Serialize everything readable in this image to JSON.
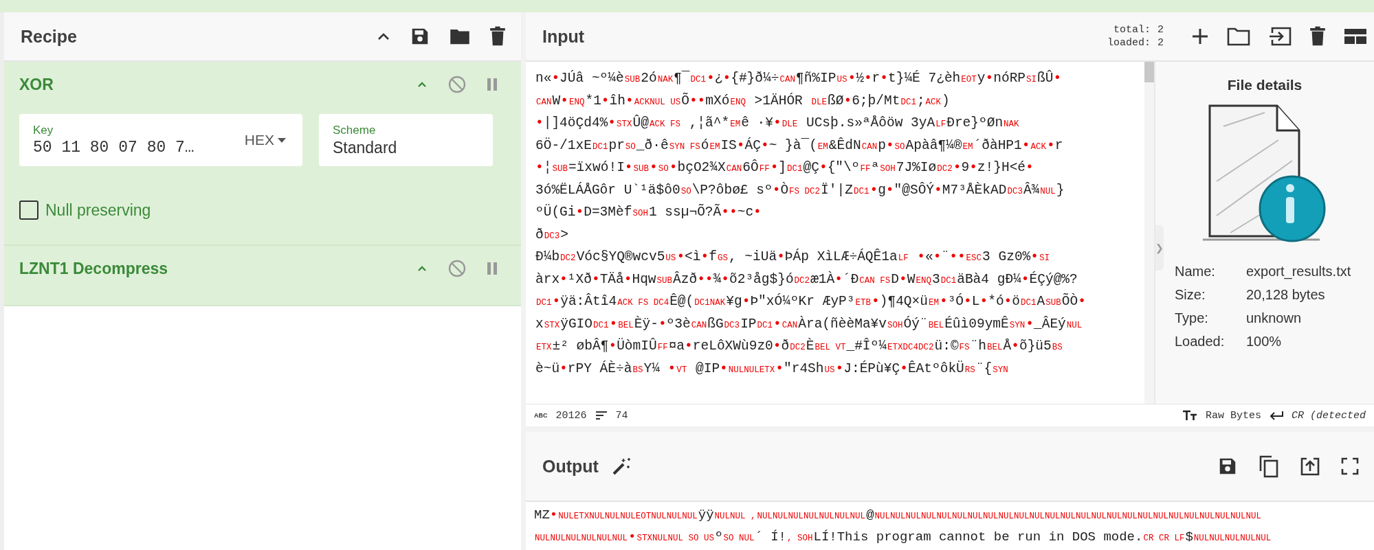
{
  "recipe": {
    "title": "Recipe",
    "operations": [
      {
        "kind": "xor",
        "name": "XOR",
        "key": {
          "label": "Key",
          "value": "50 11 80 07 80 7…",
          "format": "HEX"
        },
        "scheme": {
          "label": "Scheme",
          "value": "Standard"
        },
        "null_preserving": {
          "label": "Null preserving",
          "checked": false
        }
      },
      {
        "kind": "plain",
        "name": "LZNT1 Decompress"
      }
    ]
  },
  "input": {
    "title": "Input",
    "total_label": "total:",
    "total": "2",
    "loaded_label": "loaded:",
    "loaded": "2",
    "lines": [
      [
        {
          "s": "n«"
        },
        {
          "m": "•"
        },
        {
          "s": "JÚâ ~º¼è"
        },
        {
          "c": "SUB"
        },
        {
          "s": "2ó"
        },
        {
          "c": "NAK"
        },
        {
          "s": "¶¯"
        },
        {
          "c": "DC1"
        },
        {
          "m": "•"
        },
        {
          "s": "¿"
        },
        {
          "m": "•"
        },
        {
          "s": "{#}ð¼÷"
        },
        {
          "c": "CAN"
        },
        {
          "s": "¶ñ%IP"
        },
        {
          "c": "US"
        },
        {
          "m": "•"
        },
        {
          "s": "½"
        },
        {
          "m": "•"
        },
        {
          "s": "r"
        },
        {
          "m": "•"
        },
        {
          "s": "t}¼É 7¿èh"
        },
        {
          "c": "EOT"
        },
        {
          "s": "y"
        },
        {
          "m": "•"
        },
        {
          "s": "nóRP"
        },
        {
          "c": "SI"
        },
        {
          "s": "ßÛ"
        },
        {
          "m": "•"
        }
      ],
      [
        {
          "c": "CAN"
        },
        {
          "s": "W"
        },
        {
          "m": "•"
        },
        {
          "c": "ENQ"
        },
        {
          "s": "*1"
        },
        {
          "m": "•"
        },
        {
          "s": "îh"
        },
        {
          "m": "•"
        },
        {
          "c": "ACKNUL US"
        },
        {
          "s": "Õ"
        },
        {
          "m": "••"
        },
        {
          "s": "mXó"
        },
        {
          "c": "ENQ"
        },
        {
          "s": " >1ÄHÓR "
        },
        {
          "c": "DLE"
        },
        {
          "s": "ßØ"
        },
        {
          "m": "•"
        },
        {
          "s": "6;þ/Mt"
        },
        {
          "c": "DC1"
        },
        {
          "s": ";"
        },
        {
          "c": "ACK"
        },
        {
          "s": ")"
        }
      ],
      [
        {
          "m": "•"
        },
        {
          "s": "|]4öÇd4%"
        },
        {
          "m": "•"
        },
        {
          "c": "STX"
        },
        {
          "s": "Û@"
        },
        {
          "c": "ACK FS"
        },
        {
          "s": " ,¦ã^*"
        },
        {
          "c": "EM"
        },
        {
          "s": "ê ·¥"
        },
        {
          "m": "•"
        },
        {
          "c": "DLE"
        },
        {
          "s": " UCsþ.s»ªÅôöw 3yA"
        },
        {
          "c": "LF"
        },
        {
          "s": "Ðre}ºØn"
        },
        {
          "c": "NAK"
        }
      ],
      [
        {
          "s": "6Ö-/1xE"
        },
        {
          "c": "DC1"
        },
        {
          "s": "pr"
        },
        {
          "c": "SO"
        },
        {
          "s": "_ð·ê"
        },
        {
          "c": "SYN FS"
        },
        {
          "s": "ó"
        },
        {
          "c": "EM"
        },
        {
          "s": "IS"
        },
        {
          "m": "•"
        },
        {
          "s": "ÁÇ"
        },
        {
          "m": "•"
        },
        {
          "s": "~ }à¯("
        },
        {
          "c": "EM"
        },
        {
          "s": "&ÊdN"
        },
        {
          "c": "CAN"
        },
        {
          "s": "p"
        },
        {
          "m": "•"
        },
        {
          "c": "SO"
        },
        {
          "s": "Apàâ¶¼®"
        },
        {
          "c": "EM"
        },
        {
          "s": "´ðàHP1"
        },
        {
          "m": "•"
        },
        {
          "c": "ACK"
        },
        {
          "m": "•"
        },
        {
          "s": "r"
        }
      ],
      [
        {
          "m": "•"
        },
        {
          "s": "¦"
        },
        {
          "c": "SUB"
        },
        {
          "s": "=ïxwó!I"
        },
        {
          "m": "•"
        },
        {
          "c": "SUB"
        },
        {
          "m": "•"
        },
        {
          "c": "SO"
        },
        {
          "m": "•"
        },
        {
          "s": "bçO2¾X"
        },
        {
          "c": "CAN"
        },
        {
          "s": "6Ô"
        },
        {
          "c": "FF"
        },
        {
          "m": "•"
        },
        {
          "s": "]"
        },
        {
          "c": "DC1"
        },
        {
          "s": "@Ç"
        },
        {
          "m": "•"
        },
        {
          "s": "{\"\\º"
        },
        {
          "c": "FF"
        },
        {
          "s": "ª"
        },
        {
          "c": "SOH"
        },
        {
          "s": "7J%Iø"
        },
        {
          "c": "DC2"
        },
        {
          "m": "•"
        },
        {
          "s": "9"
        },
        {
          "m": "•"
        },
        {
          "s": "z!}H<é"
        },
        {
          "m": "•"
        }
      ],
      [
        {
          "s": "3ó%ËLÁÅGôr U`¹ä$ô0"
        },
        {
          "c": "SO"
        },
        {
          "s": "\\P?ôbø£ sº"
        },
        {
          "m": "•"
        },
        {
          "s": "Ò"
        },
        {
          "c": "FS DC2"
        },
        {
          "s": "Ï'|Z"
        },
        {
          "c": "DC1"
        },
        {
          "m": "•"
        },
        {
          "s": "g"
        },
        {
          "m": "•"
        },
        {
          "s": "\"@SÔÝ"
        },
        {
          "m": "•"
        },
        {
          "s": "M7³ÅÈkAD"
        },
        {
          "c": "DC3"
        },
        {
          "s": "Â"
        },
        {
          "s": "¾"
        },
        {
          "c": "NUL"
        },
        {
          "s": "}"
        }
      ],
      [
        {
          "s": "ºÜ(Gi"
        },
        {
          "m": "•"
        },
        {
          "s": "D=3Mèf"
        },
        {
          "c": "SOH"
        },
        {
          "s": "1 ssµ¬Õ?Ã"
        },
        {
          "m": "••"
        },
        {
          "s": "~c"
        },
        {
          "m": "•"
        }
      ],
      [
        {
          "s": "ð"
        },
        {
          "c": "DC3"
        },
        {
          "s": ">"
        }
      ],
      [
        {
          "s": "Ð¼b"
        },
        {
          "c": "DC2"
        },
        {
          "s": "Vóc§YQ®wcv5"
        },
        {
          "c": "US"
        },
        {
          "m": "•"
        },
        {
          "s": "<ì"
        },
        {
          "m": "•"
        },
        {
          "s": "f"
        },
        {
          "c": "GS"
        },
        {
          "s": ",   ~iUä"
        },
        {
          "m": "•"
        },
        {
          "s": "ÞÁp XìLÆ÷ÁQÊ1a"
        },
        {
          "c": "LF"
        },
        {
          "m": " •"
        },
        {
          "s": "«"
        },
        {
          "m": "•"
        },
        {
          "s": "¨"
        },
        {
          "m": "••"
        },
        {
          "c": "ESC"
        },
        {
          "s": "3 Gz0%"
        },
        {
          "m": "•"
        },
        {
          "c": "SI"
        }
      ],
      [
        {
          "s": "àrx"
        },
        {
          "m": "•"
        },
        {
          "s": "¹Xð"
        },
        {
          "m": "•"
        },
        {
          "s": "TÄå"
        },
        {
          "m": "•"
        },
        {
          "s": "Hqw"
        },
        {
          "c": "SUB"
        },
        {
          "s": "Âzð"
        },
        {
          "m": "••"
        },
        {
          "s": "¾"
        },
        {
          "m": "•"
        },
        {
          "s": "õ2³åg$}ó"
        },
        {
          "c": "DC2"
        },
        {
          "s": "æ1À"
        },
        {
          "m": "•"
        },
        {
          "s": "´Ð"
        },
        {
          "c": "CAN FS"
        },
        {
          "s": "D"
        },
        {
          "m": "•"
        },
        {
          "s": "W"
        },
        {
          "c": "ENQ"
        },
        {
          "s": "3"
        },
        {
          "c": "DC1"
        },
        {
          "s": "äBà4 gÐ¼"
        },
        {
          "m": "•"
        },
        {
          "s": "ÉÇý@%?"
        }
      ],
      [
        {
          "c": "DC1"
        },
        {
          "m": "•"
        },
        {
          "s": "ÿä:Âtî4"
        },
        {
          "c": "ACK FS DC4"
        },
        {
          "s": "Ê@("
        },
        {
          "c": "DC1NAK"
        },
        {
          "s": "¥g"
        },
        {
          "m": "•"
        },
        {
          "s": "Þ\"xÓ¼ºKr ÆyP³"
        },
        {
          "c": "ETB"
        },
        {
          "m": "•"
        },
        {
          "s": ")¶4Q×ü"
        },
        {
          "c": "EM"
        },
        {
          "m": "•"
        },
        {
          "s": "³Ó"
        },
        {
          "m": "•"
        },
        {
          "s": "L"
        },
        {
          "m": "•"
        },
        {
          "s": "*ó"
        },
        {
          "m": "•"
        },
        {
          "s": "ö"
        },
        {
          "c": "DC1"
        },
        {
          "s": "A"
        },
        {
          "c": "SUB"
        },
        {
          "s": "ÕÒ"
        },
        {
          "m": "•"
        }
      ],
      [
        {
          "s": "x"
        },
        {
          "c": "STX"
        },
        {
          "s": "ÿGIO"
        },
        {
          "c": "DC1"
        },
        {
          "m": "•"
        },
        {
          "c": "BEL"
        },
        {
          "s": "Èÿ-"
        },
        {
          "m": "•"
        },
        {
          "s": "º3è"
        },
        {
          "c": "CAN"
        },
        {
          "s": "ßG"
        },
        {
          "c": "DC3"
        },
        {
          "s": "IP"
        },
        {
          "c": "DC1"
        },
        {
          "m": "•"
        },
        {
          "c": "CAN"
        },
        {
          "s": "Àra(ñèèMa¥v"
        },
        {
          "c": "SOH"
        },
        {
          "s": "Óý¨"
        },
        {
          "c": "BEL"
        },
        {
          "s": "Éûì09ymÊ"
        },
        {
          "c": "SYN"
        },
        {
          "m": "•"
        },
        {
          "s": "_ÂEý"
        },
        {
          "c": "NUL"
        }
      ],
      [
        {
          "c": "ETX"
        },
        {
          "s": "±² øbÂ"
        },
        {
          "s": "¶"
        },
        {
          "m": "•"
        },
        {
          "s": "ÜòmIÛ"
        },
        {
          "c": "FF"
        },
        {
          "s": "¤a"
        },
        {
          "m": "•"
        },
        {
          "s": "reLôXWù9z0"
        },
        {
          "m": "•"
        },
        {
          "s": "ð"
        },
        {
          "c": "DC2"
        },
        {
          "s": "È"
        },
        {
          "c": "BEL VT"
        },
        {
          "s": "_#Îº¼"
        },
        {
          "c": "ETXDC4DC2"
        },
        {
          "s": "ü:©"
        },
        {
          "c": "FS"
        },
        {
          "s": "¨h"
        },
        {
          "c": "BEL"
        },
        {
          "s": "Å"
        },
        {
          "m": "•"
        },
        {
          "s": "õ}ü5"
        },
        {
          "c": "BS"
        }
      ],
      [
        {
          "s": "è~ü"
        },
        {
          "m": "•"
        },
        {
          "s": "rPY ÁÈ÷à"
        },
        {
          "c": "BS"
        },
        {
          "s": "Y¼ "
        },
        {
          "m": "•"
        },
        {
          "c": "VT"
        },
        {
          "s": " @IP"
        },
        {
          "m": "•"
        },
        {
          "c": "NULNULETX"
        },
        {
          "m": "•"
        },
        {
          "s": "\"r4Sh"
        },
        {
          "c": "US"
        },
        {
          "m": "•"
        },
        {
          "s": "J:ÉPù¥Ç"
        },
        {
          "m": "•"
        },
        {
          "s": "ÊAtºôkÜ"
        },
        {
          "c": "RS"
        },
        {
          "s": "¨{"
        },
        {
          "c": "SYN"
        }
      ]
    ]
  },
  "file_details": {
    "title": "File details",
    "fields": [
      {
        "label": "Name:",
        "value": "export_results.txt"
      },
      {
        "label": "Size:",
        "value": "20,128 bytes"
      },
      {
        "label": "Type:",
        "value": "unknown"
      },
      {
        "label": "Loaded:",
        "value": "100%"
      }
    ],
    "handle": "❯"
  },
  "status_bar": {
    "abc": "ABC",
    "chars": "20126",
    "lines": "74",
    "encoding": "Raw Bytes",
    "eol": "CR (detected"
  },
  "output": {
    "title": "Output",
    "lines": [
      [
        {
          "s": "MZ"
        },
        {
          "m": "•"
        },
        {
          "c": "NULETXNULNULNULEOTNULNULNUL"
        },
        {
          "s": "ÿÿ"
        },
        {
          "c": "NULNUL ,"
        },
        {
          "c": "NULNULNULNULNULNULNUL"
        },
        {
          "s": "@"
        },
        {
          "c": "NULNULNULNULNULNULNULNULNULNULNULNULNULNULNULNULNULNULNULNULNULNULNULNULNUL"
        }
      ],
      [
        {
          "c": "NULNULNULNULNULNUL"
        },
        {
          "m": "•"
        },
        {
          "c": "STXNULNUL SO US"
        },
        {
          "s": "º"
        },
        {
          "c": "SO NUL"
        },
        {
          "s": "´ Í!"
        },
        {
          "c": ", SOH"
        },
        {
          "s": "LÍ!This program cannot be run in DOS mode."
        },
        {
          "c": "CR CR LF"
        },
        {
          "s": "$"
        },
        {
          "c": "NULNULNULNULNUL"
        }
      ]
    ]
  }
}
